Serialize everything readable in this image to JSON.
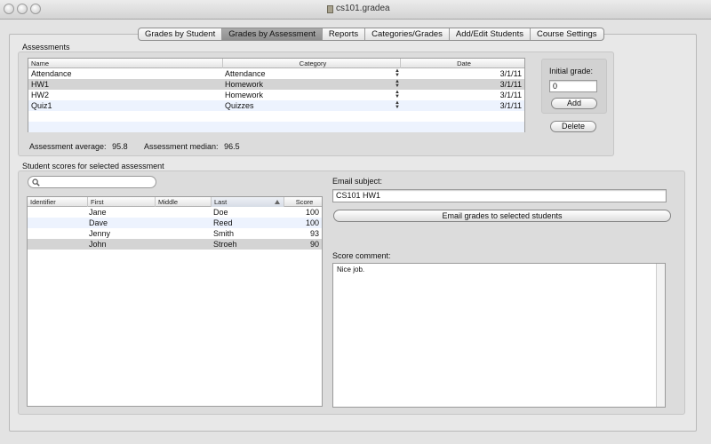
{
  "window": {
    "title": "cs101.gradea"
  },
  "tabs": [
    {
      "label": "Grades by Student",
      "active": false
    },
    {
      "label": "Grades by Assessment",
      "active": true
    },
    {
      "label": "Reports",
      "active": false
    },
    {
      "label": "Categories/Grades",
      "active": false
    },
    {
      "label": "Add/Edit Students",
      "active": false
    },
    {
      "label": "Course Settings",
      "active": false
    }
  ],
  "assessments": {
    "label": "Assessments",
    "columns": {
      "name": "Name",
      "category": "Category",
      "date": "Date"
    },
    "rows": [
      {
        "name": "Attendance",
        "category": "Attendance",
        "date": "3/1/11"
      },
      {
        "name": "HW1",
        "category": "Homework",
        "date": "3/1/11"
      },
      {
        "name": "HW2",
        "category": "Homework",
        "date": "3/1/11"
      },
      {
        "name": "Quiz1",
        "category": "Quizzes",
        "date": "3/1/11"
      }
    ],
    "average_label": "Assessment average:",
    "average_value": "95.8",
    "median_label": "Assessment median:",
    "median_value": "96.5",
    "initial_grade_label": "Initial grade:",
    "initial_grade_value": "0",
    "add_label": "Add",
    "delete_label": "Delete"
  },
  "scores": {
    "label": "Student scores for selected assessment",
    "search_value": "",
    "columns": {
      "identifier": "Identifier",
      "first": "First",
      "middle": "Middle",
      "last": "Last",
      "score": "Score"
    },
    "rows": [
      {
        "identifier": "",
        "first": "Jane",
        "middle": "",
        "last": "Doe",
        "score": "100"
      },
      {
        "identifier": "",
        "first": "Dave",
        "middle": "",
        "last": "Reed",
        "score": "100"
      },
      {
        "identifier": "",
        "first": "Jenny",
        "middle": "",
        "last": "Smith",
        "score": "93"
      },
      {
        "identifier": "",
        "first": "John",
        "middle": "",
        "last": "Stroeh",
        "score": "90"
      }
    ]
  },
  "email": {
    "subject_label": "Email subject:",
    "subject_value": "CS101 HW1",
    "send_label": "Email grades to selected students",
    "comment_label": "Score comment:",
    "comment_value": "Nice job."
  },
  "icons": {
    "search": "magnifier-icon",
    "sort": "sort-ascending-icon",
    "stepper": "popup-stepper-icon"
  }
}
